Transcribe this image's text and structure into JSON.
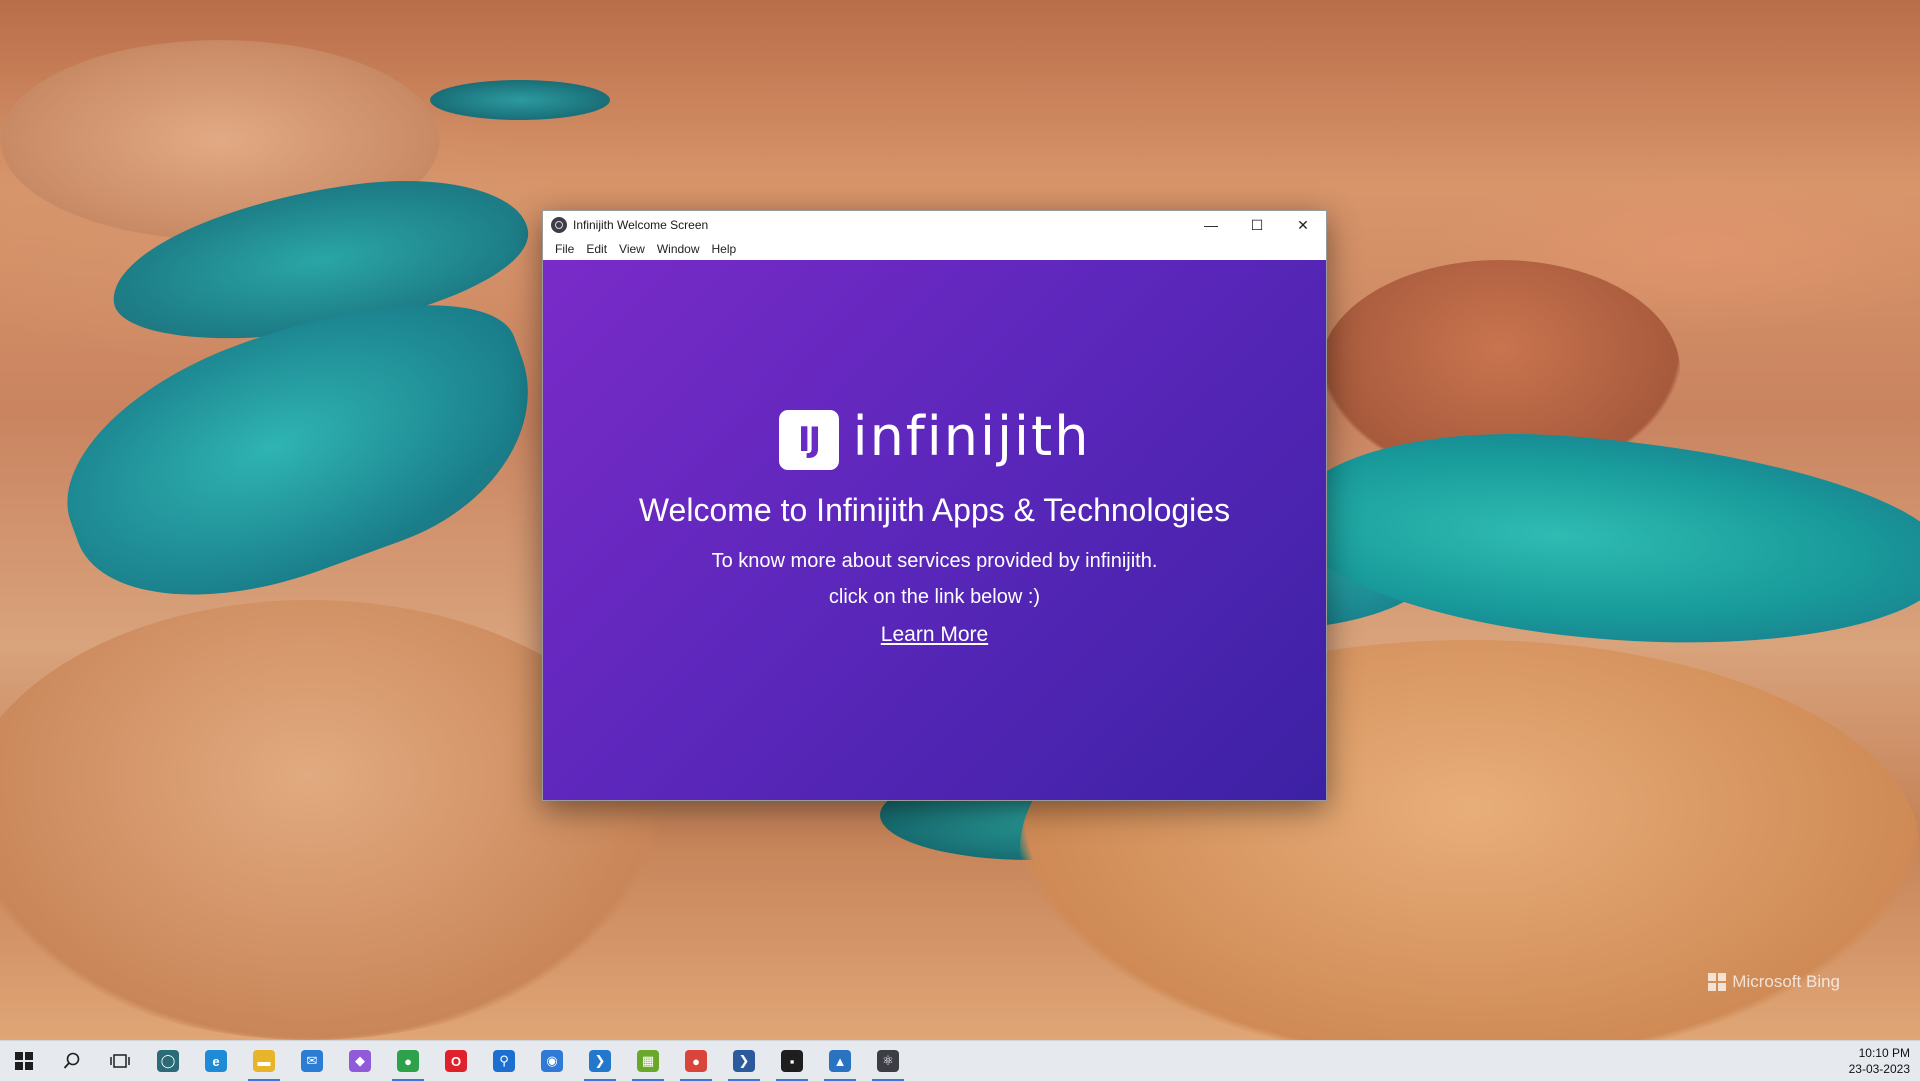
{
  "window": {
    "title": "Infinijith Welcome Screen",
    "menu": [
      "File",
      "Edit",
      "View",
      "Window",
      "Help"
    ],
    "controls": {
      "minimize": "—",
      "maximize": "☐",
      "close": "✕"
    }
  },
  "content": {
    "logo_mark": "IJ",
    "logo_text": "infinijith",
    "heading": "Welcome to Infinijith Apps & Technologies",
    "line1": "To know more about services provided by infinijith.",
    "line2": "click on the link below :)",
    "link": "Learn More"
  },
  "desktop": {
    "watermark": "Microsoft Bing"
  },
  "taskbar": {
    "apps": [
      {
        "name": "cortana-icon",
        "glyph": "◯",
        "color": "#2a6b77"
      },
      {
        "name": "edge-icon",
        "glyph": "e",
        "color": "#1f8ad6"
      },
      {
        "name": "file-explorer-icon",
        "glyph": "▬",
        "color": "#e8b52a"
      },
      {
        "name": "mail-icon",
        "glyph": "✉",
        "color": "#2b7cd3"
      },
      {
        "name": "copilot-icon",
        "glyph": "◆",
        "color": "#8f5bd8"
      },
      {
        "name": "chrome-profile-icon",
        "glyph": "●",
        "color": "#2ea24a"
      },
      {
        "name": "opera-icon",
        "glyph": "O",
        "color": "#e0202a"
      },
      {
        "name": "maps-icon",
        "glyph": "⚲",
        "color": "#1c6fd1"
      },
      {
        "name": "firefox-icon",
        "glyph": "◉",
        "color": "#2e7ad6"
      },
      {
        "name": "vscode-icon",
        "glyph": "❯",
        "color": "#2478cc"
      },
      {
        "name": "spreadsheet-icon",
        "glyph": "▦",
        "color": "#6aa82c"
      },
      {
        "name": "chrome-icon",
        "glyph": "●",
        "color": "#d9453a"
      },
      {
        "name": "powershell-icon",
        "glyph": "❯",
        "color": "#2b5b9c"
      },
      {
        "name": "terminal-icon",
        "glyph": "▪",
        "color": "#1e1e1e"
      },
      {
        "name": "photos-icon",
        "glyph": "▲",
        "color": "#2a73c0"
      },
      {
        "name": "electron-app-icon",
        "glyph": "⚛",
        "color": "#3d3d46"
      }
    ],
    "time": "10:10 PM",
    "date": "23-03-2023"
  }
}
